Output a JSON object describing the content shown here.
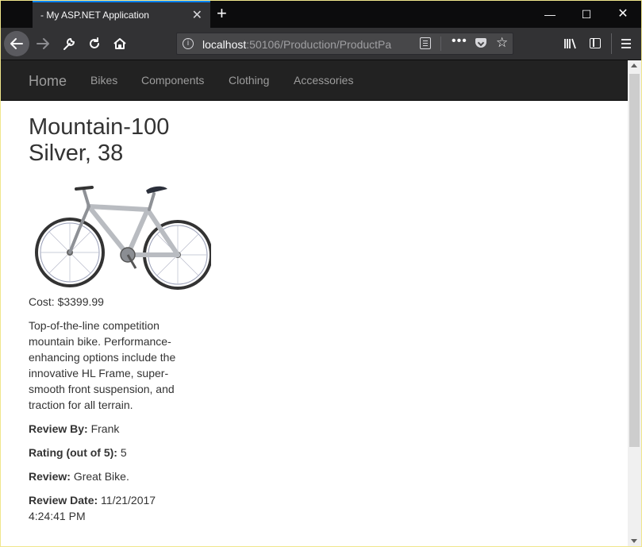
{
  "browser": {
    "tab_title": "- My ASP.NET Application",
    "tab_close": "✕",
    "new_tab": "+",
    "url_host": "localhost",
    "url_rest": ":50106/Production/ProductPa",
    "window_controls": {
      "minimize": "—",
      "maximize": "☐",
      "close": "✕"
    }
  },
  "site_nav": {
    "brand": "Home",
    "links": [
      "Bikes",
      "Components",
      "Clothing",
      "Accessories"
    ]
  },
  "product": {
    "title": "Mountain-100 Silver, 38",
    "cost_label": "Cost: $3399.99",
    "description": "Top-of-the-line competition mountain bike. Performance-enhancing options include the innovative HL Frame, super-smooth front suspension, and traction for all terrain.",
    "review_by_label": "Review By:",
    "review_by_value": "Frank",
    "rating_label": "Rating (out of 5):",
    "rating_value": "5",
    "review_label": "Review:",
    "review_value": "Great Bike.",
    "review_date_label": "Review Date:",
    "review_date_value": "11/21/2017 4:24:41 PM"
  },
  "colors": {
    "navbar_bg": "#222222",
    "nav_text": "#9d9d9d",
    "browser_chrome": "#323234",
    "tab_accent": "#0a84ff"
  }
}
